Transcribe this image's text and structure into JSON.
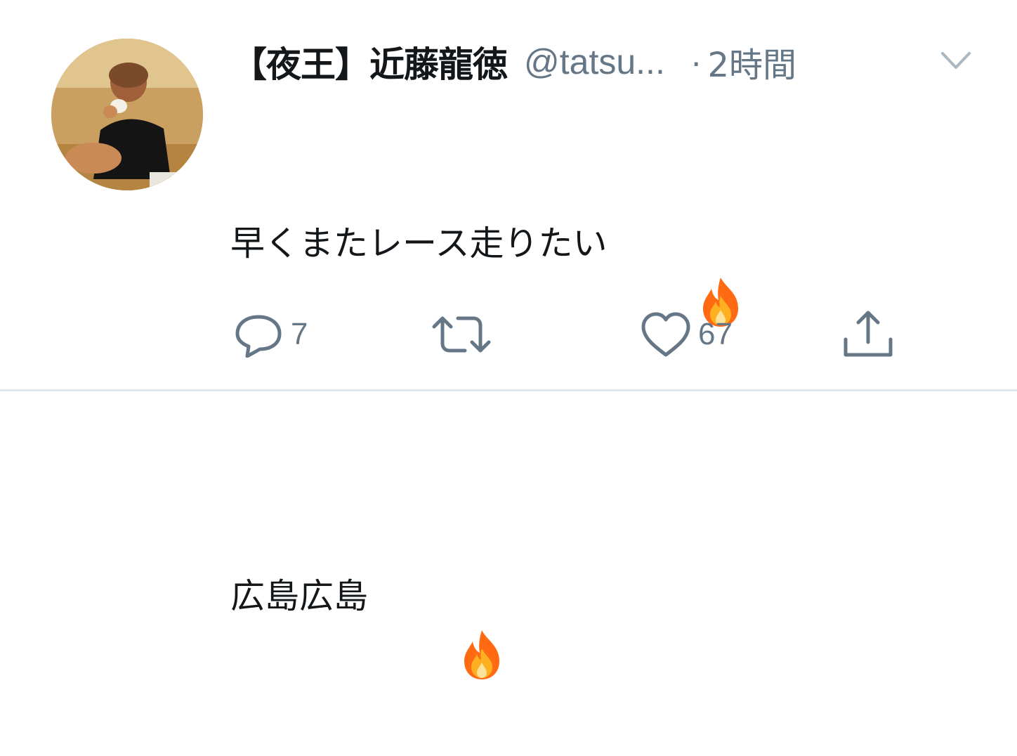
{
  "tweet": {
    "display_name": "【夜王】近藤龍徳",
    "handle": "@tatsu...",
    "separator": "·",
    "time": "2時間",
    "lines": [
      "早くまたレース走りたい",
      "広島広島"
    ],
    "emoji": "🔥"
  },
  "actions": {
    "reply_count": "7",
    "retweet_count": "",
    "like_count": "67"
  },
  "icons": {
    "reply": "reply-icon",
    "retweet": "retweet-icon",
    "like": "heart-icon",
    "share": "share-icon",
    "more": "chevron-down-icon"
  },
  "colors": {
    "text": "#14171a",
    "secondary": "#657786",
    "divider": "#e1e8ed"
  }
}
